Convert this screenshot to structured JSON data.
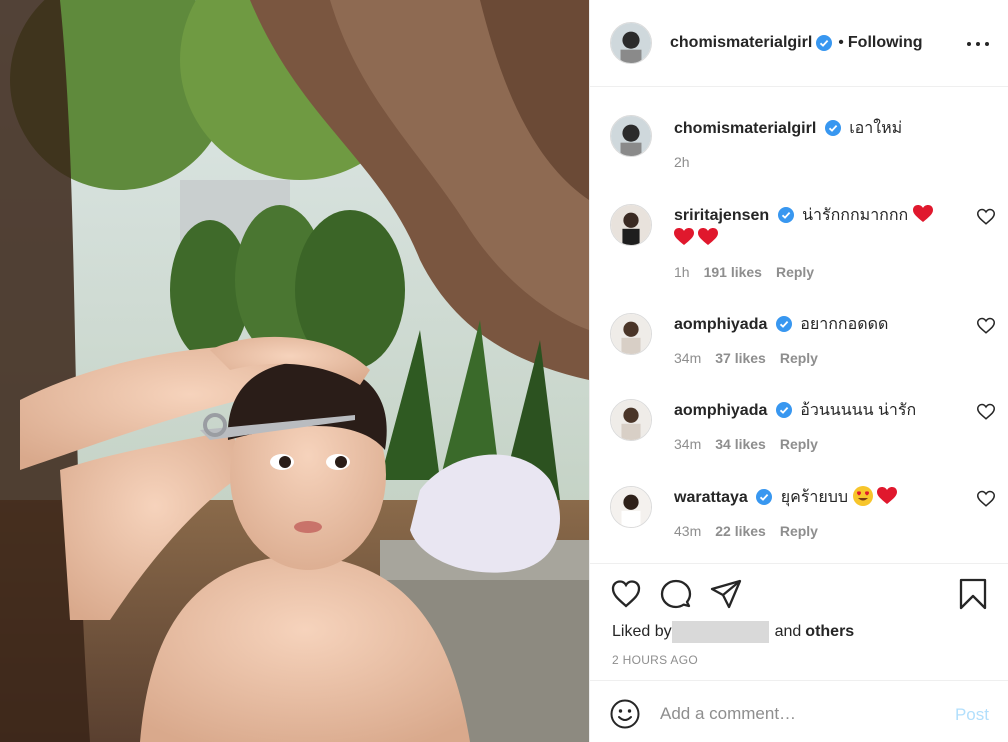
{
  "post": {
    "author": "chomismaterialgirl",
    "follow_status": "Following",
    "header_separator": "•",
    "caption": "เอาใหม่",
    "caption_time": "2h"
  },
  "comments": [
    {
      "username": "sriritajensen",
      "text": "น่ารักกกมากกก",
      "time": "1h",
      "likes": "191 likes",
      "reply": "Reply"
    },
    {
      "username": "aomphiyada",
      "text": "อยากกอดดด",
      "time": "34m",
      "likes": "37 likes",
      "reply": "Reply"
    },
    {
      "username": "aomphiyada",
      "text": "อ้วนนนนน น่ารัก",
      "time": "34m",
      "likes": "34 likes",
      "reply": "Reply"
    },
    {
      "username": "warattaya",
      "text": "ยุคร้ายบบ",
      "time": "43m",
      "likes": "22 likes",
      "reply": "Reply"
    }
  ],
  "likes_summary": {
    "prefix": "Liked by",
    "connector": "and",
    "others": "others"
  },
  "timestamp": "2 HOURS AGO",
  "add_comment": {
    "placeholder": "Add a comment…",
    "post_label": "Post"
  },
  "icons": {
    "more": "more-options-icon",
    "like": "heart-outline-icon",
    "comment": "comment-bubble-icon",
    "share": "paper-plane-icon",
    "save": "bookmark-icon",
    "emoji": "emoji-smiley-icon",
    "verified": "verified-badge-icon"
  },
  "colors": {
    "text": "#262626",
    "muted": "#8e8e8e",
    "verified": "#3897f0",
    "post_disabled": "#b2dffc",
    "heart_emoji": "#e0182d"
  }
}
